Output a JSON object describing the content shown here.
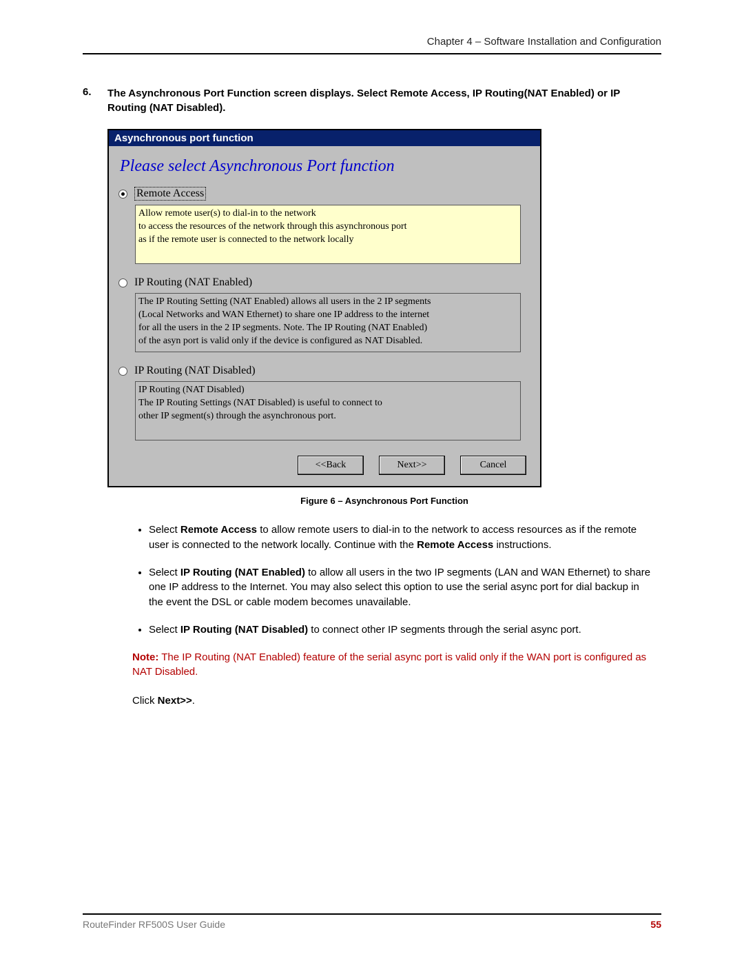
{
  "header": {
    "chapter": "Chapter 4 – Software Installation and Configuration"
  },
  "step": {
    "num": "6.",
    "text": "The Asynchronous Port Function screen displays. Select Remote Access, IP Routing(NAT Enabled) or IP Routing (NAT Disabled)."
  },
  "window": {
    "title": "Asynchronous port function",
    "heading": "Please select Asynchronous Port function",
    "options": [
      {
        "label": "Remote Access",
        "selected": true,
        "desc": "Allow remote user(s) to dial-in to the network\nto access the resources of the network through this asynchronous port\nas if the remote user is connected to the network locally"
      },
      {
        "label": "IP Routing (NAT Enabled)",
        "selected": false,
        "desc": "The IP Routing Setting (NAT Enabled) allows all users in the 2 IP segments\n(Local Networks and WAN Ethernet) to share one IP address to the internet\nfor all the users in the 2 IP segments. Note. The IP Routing (NAT Enabled)\nof the asyn port is valid only if the device is configured as NAT Disabled."
      },
      {
        "label": "IP Routing (NAT Disabled)",
        "selected": false,
        "desc": "IP Routing (NAT Disabled)\nThe IP Routing Settings (NAT Disabled) is useful to connect to\nother IP segment(s) through the asynchronous port."
      }
    ],
    "buttons": {
      "back": "<<Back",
      "next": "Next>>",
      "cancel": "Cancel"
    }
  },
  "caption": "Figure 6 – Asynchronous Port Function",
  "bullets": [
    {
      "pre": "Select ",
      "bold": "Remote Access",
      "mid": " to allow remote users to dial-in to the network to access resources as if the remote user is connected to the network locally. Continue with the ",
      "bold2": "Remote Access",
      "post": " instructions."
    },
    {
      "pre": "Select ",
      "bold": "IP Routing (NAT Enabled)",
      "mid": " to allow all users in the two IP segments (LAN and WAN Ethernet) to share one IP address to the Internet. You may also select this option to use the serial async port for dial backup in the event the DSL or cable modem becomes unavailable.",
      "bold2": "",
      "post": ""
    },
    {
      "pre": "Select ",
      "bold": "IP Routing (NAT Disabled)",
      "mid": " to connect other IP segments through the serial async port.",
      "bold2": "",
      "post": ""
    }
  ],
  "note": {
    "label": "Note:",
    "text": " The IP Routing (NAT Enabled) feature of the serial async port is valid only if the WAN port is configured as NAT Disabled."
  },
  "click_next": {
    "pre": "Click ",
    "bold": "Next>>",
    "post": "."
  },
  "footer": {
    "left": "RouteFinder RF500S User Guide",
    "page": "55"
  }
}
